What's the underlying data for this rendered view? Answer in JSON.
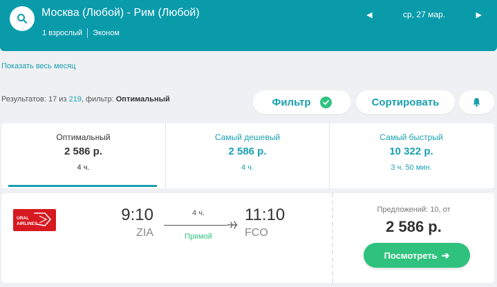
{
  "header": {
    "route": "Москва (Любой) - Рим (Любой)",
    "passengers": "1 взрослый",
    "cabin_class": "Эконом",
    "date": "ср, 27 мар.",
    "prev_icon": "caret-left-icon",
    "next_icon": "caret-right-icon",
    "accent_color": "#0a9bab"
  },
  "month_link": "Показать весь месяц",
  "results": {
    "prefix": "Результатов: 17 из ",
    "total": "219",
    "filter_prefix": ", фильтр: ",
    "filter_name": "Оптимальный"
  },
  "buttons": {
    "filter": "Фильтр",
    "sort": "Сортировать",
    "bell_icon": "bell-icon",
    "check_icon": "check-icon"
  },
  "sort_tabs": [
    {
      "title": "Оптимальный",
      "price": "2 586 р.",
      "duration": "4 ч."
    },
    {
      "title": "Самый дешевый",
      "price": "2 586 р.",
      "duration": "4 ч."
    },
    {
      "title": "Самый быстрый",
      "price": "10 322 р.",
      "duration": "3 ч. 50 мин."
    }
  ],
  "ticket": {
    "airline_logo_text": "URAL AIRLINES",
    "dep_time": "9:10",
    "dep_code": "ZIA",
    "arr_time": "11:10",
    "arr_code": "FCO",
    "duration": "4 ч.",
    "type": "Прямой",
    "offers": "Предложений: 10, от",
    "price": "2 586 р.",
    "view_button": "Посмотреть",
    "view_arrow": "➔"
  },
  "colors": {
    "link": "#1a9fb0",
    "success": "#2ec27e",
    "airline_red": "#d71920"
  }
}
